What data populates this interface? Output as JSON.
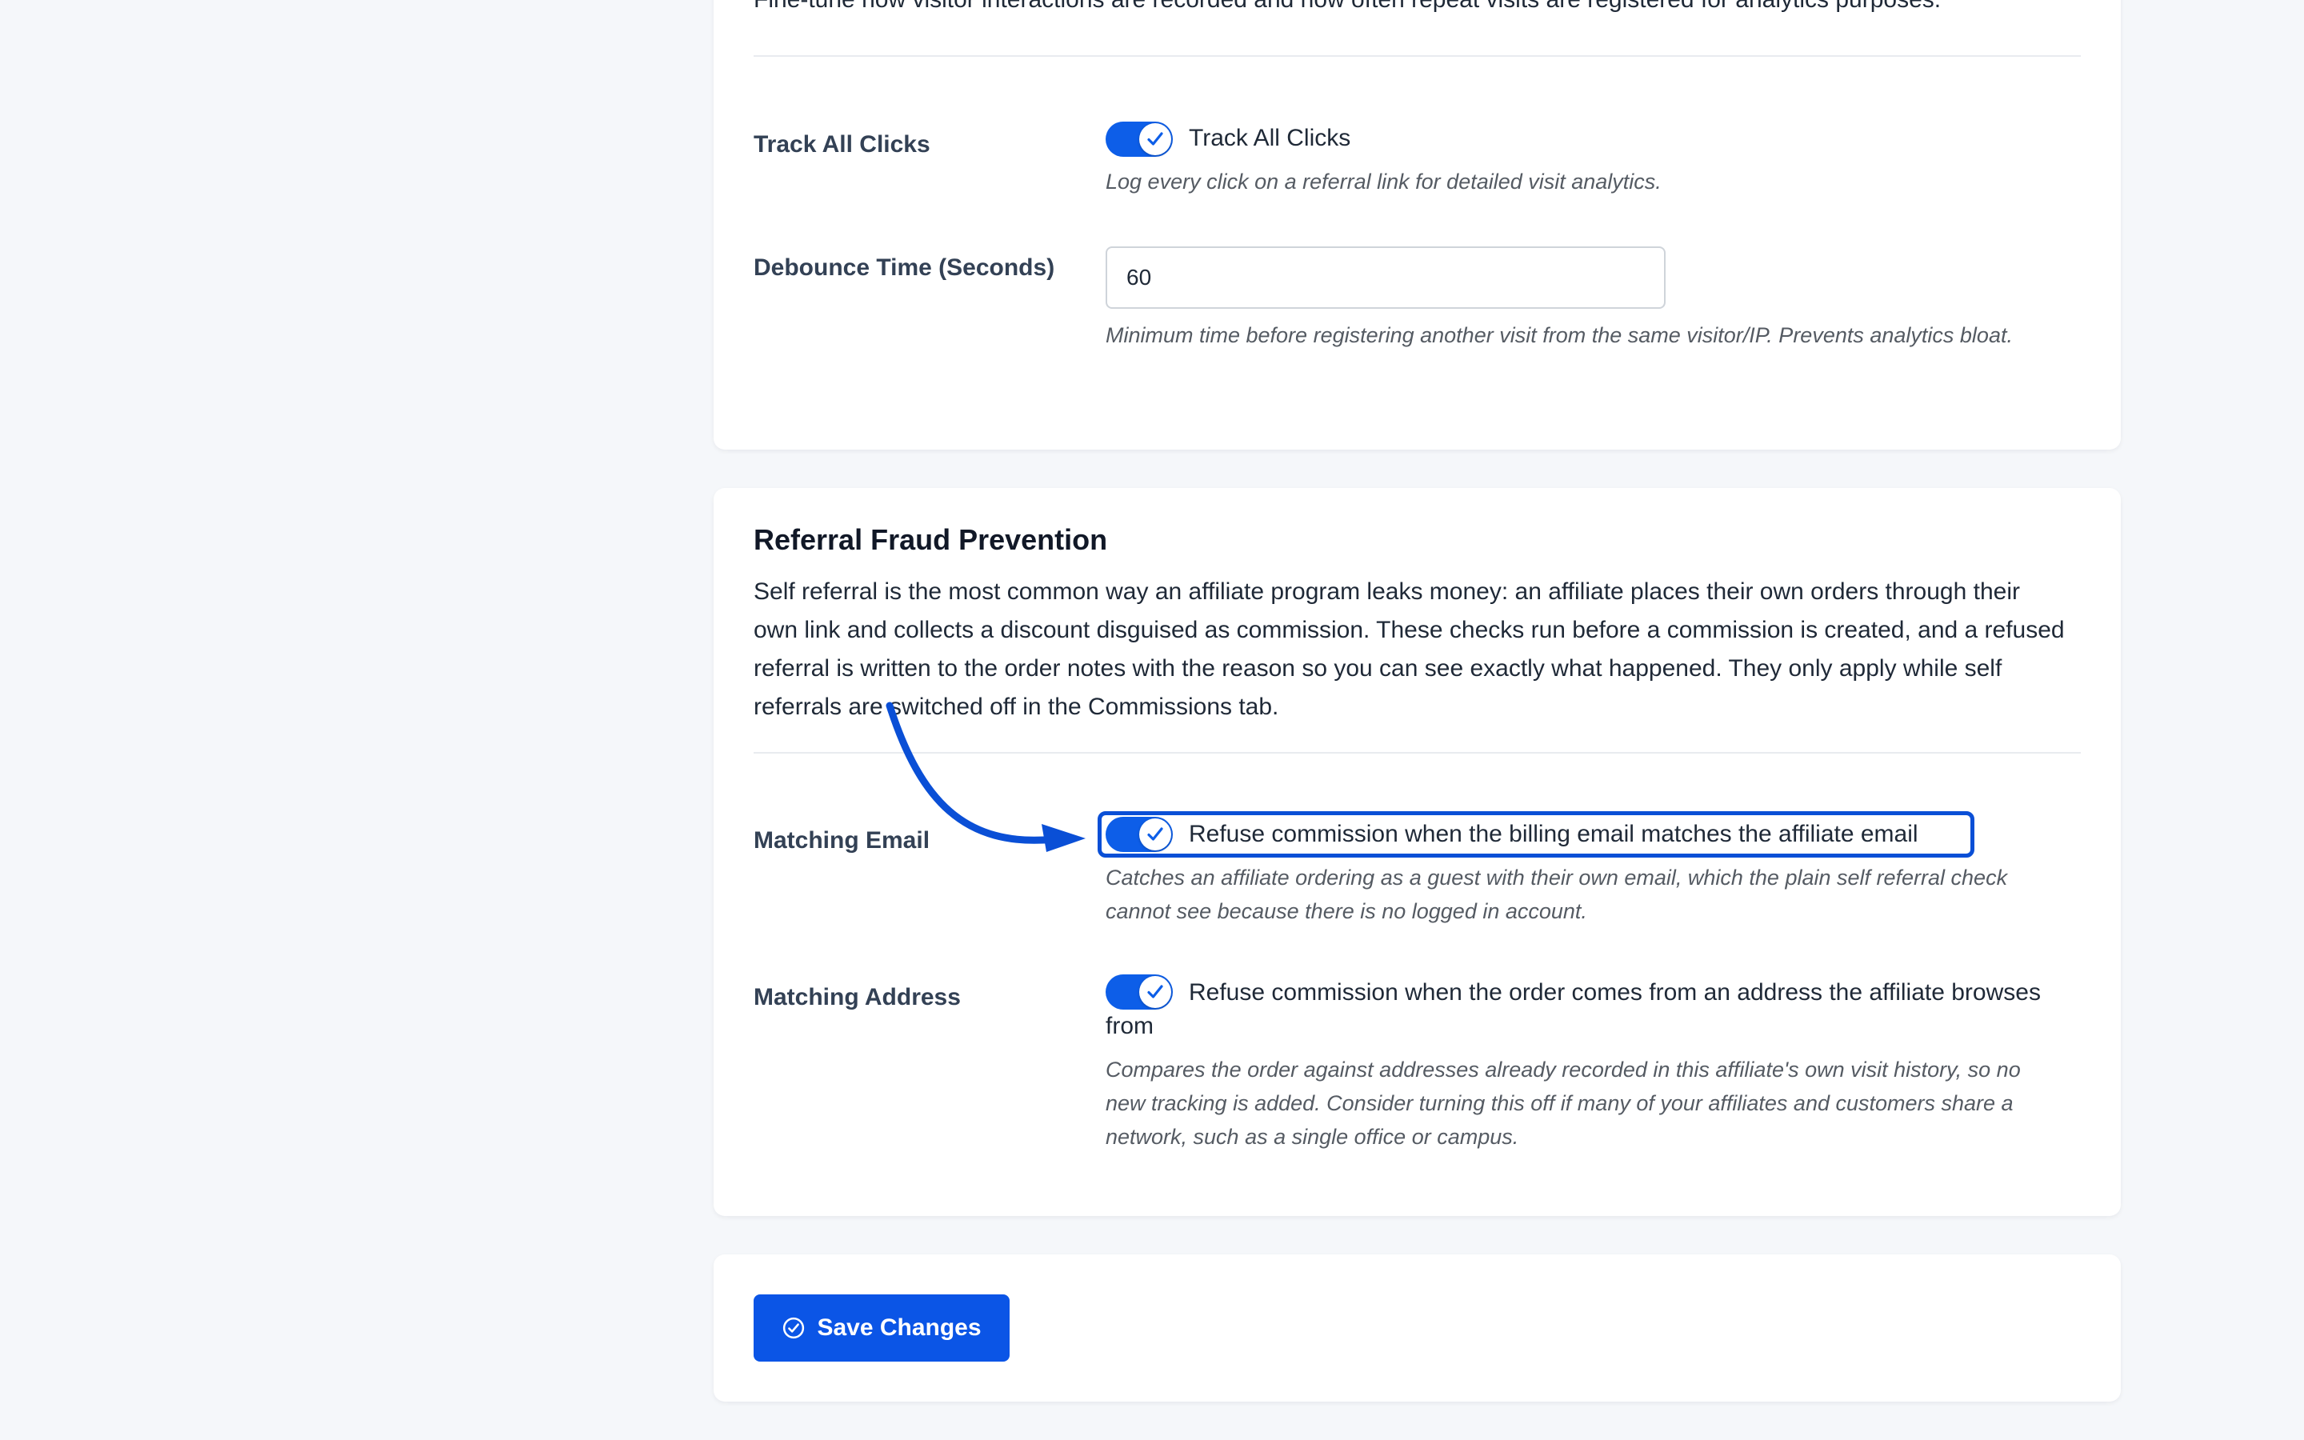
{
  "tracking": {
    "intro": "Fine-tune how visitor interactions are recorded and how often repeat visits are registered for analytics purposes.",
    "track_all_clicks": {
      "label": "Track All Clicks",
      "toggle_label": "Track All Clicks",
      "description": "Log every click on a referral link for detailed visit analytics.",
      "enabled": true
    },
    "debounce": {
      "label": "Debounce Time (Seconds)",
      "value": "60",
      "description": "Minimum time before registering another visit from the same visitor/IP. Prevents analytics bloat."
    }
  },
  "fraud": {
    "title": "Referral Fraud Prevention",
    "intro": "Self referral is the most common way an affiliate program leaks money: an affiliate places their own orders through their own link and collects a discount disguised as commission. These checks run before a commission is created, and a refused referral is written to the order notes with the reason so you can see exactly what happened. They only apply while self referrals are switched off in the Commissions tab.",
    "matching_email": {
      "label": "Matching Email",
      "toggle_label": "Refuse commission when the billing email matches the affiliate email",
      "description": "Catches an affiliate ordering as a guest with their own email, which the plain self referral check cannot see because there is no logged in account.",
      "enabled": true
    },
    "matching_address": {
      "label": "Matching Address",
      "toggle_label": "Refuse commission when the order comes from an address the affiliate browses from",
      "description": "Compares the order against addresses already recorded in this affiliate's own visit history, so no new tracking is added. Consider turning this off if many of your affiliates and customers share a network, such as a single office or campus.",
      "enabled": true
    }
  },
  "actions": {
    "save_label": "Save Changes",
    "save_icon": "check-circle-icon"
  },
  "colors": {
    "accent": "#0b55e6",
    "annotation": "#0a4fd6",
    "background": "#f5f7fa"
  }
}
